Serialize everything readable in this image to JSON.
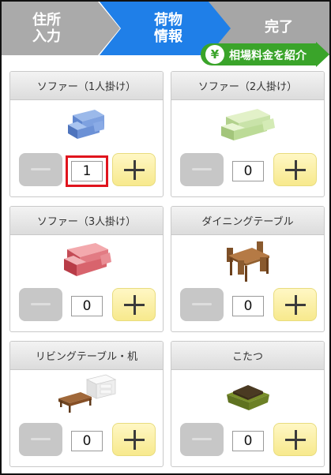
{
  "steps": [
    {
      "label": "住所\n入力",
      "state": "done"
    },
    {
      "label": "荷物\n情報",
      "state": "current"
    },
    {
      "label": "完了",
      "state": "upcoming"
    }
  ],
  "price_cta": {
    "icon": "yen-icon",
    "symbol": "¥",
    "label": "相場料金を紹介"
  },
  "colors": {
    "current_step": "#1f7fe8",
    "inactive_step": "#aaaaaa",
    "cta_green": "#3aa42a",
    "highlight": "#e0141d",
    "plus_button": "#f7e98d",
    "minus_button": "#c7c7c7"
  },
  "items": [
    {
      "name": "ソファー（1人掛け）",
      "icon": "sofa-1-seat-icon",
      "quantity": "1",
      "highlighted": true
    },
    {
      "name": "ソファー（2人掛け）",
      "icon": "sofa-2-seat-icon",
      "quantity": "0",
      "highlighted": false
    },
    {
      "name": "ソファー（3人掛け）",
      "icon": "sofa-3-seat-icon",
      "quantity": "0",
      "highlighted": false
    },
    {
      "name": "ダイニングテーブル",
      "icon": "dining-table-icon",
      "quantity": "0",
      "highlighted": false
    },
    {
      "name": "リビングテーブル・机",
      "icon": "living-table-desk-icon",
      "quantity": "0",
      "highlighted": false
    },
    {
      "name": "こたつ",
      "icon": "kotatsu-icon",
      "quantity": "0",
      "highlighted": false
    }
  ]
}
